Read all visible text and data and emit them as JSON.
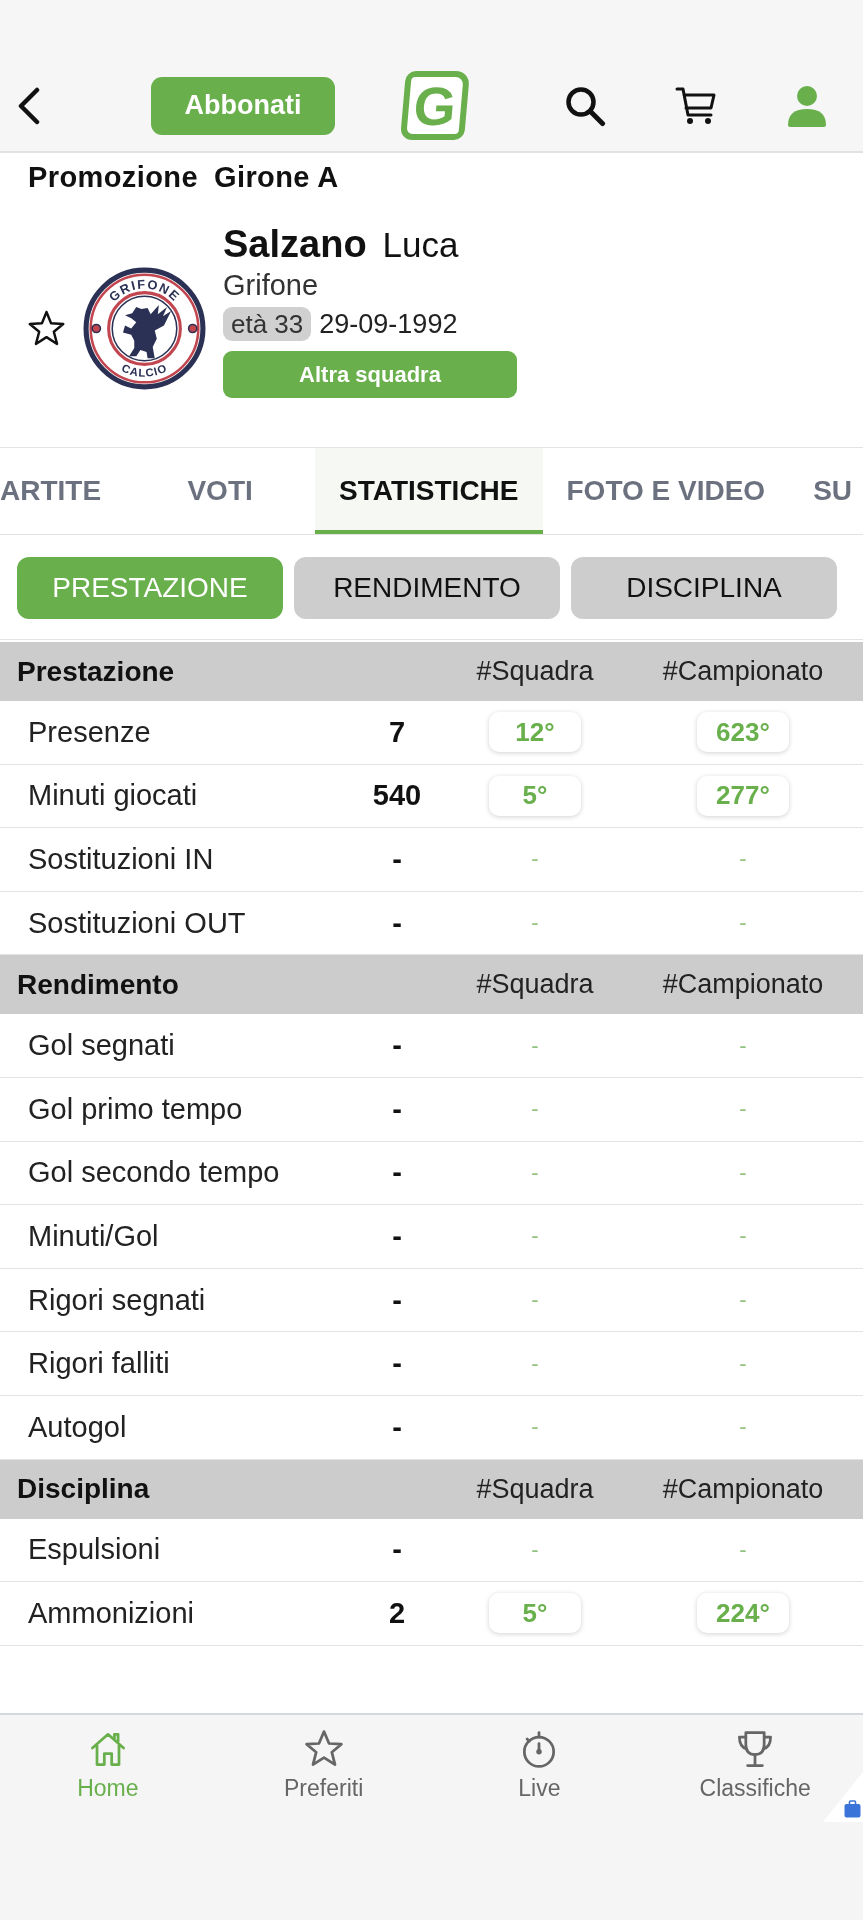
{
  "header": {
    "subscribe_button": "Abbonati",
    "logo": "G"
  },
  "competition": {
    "league": "Promozione",
    "group": "Girone A"
  },
  "player": {
    "surname": "Salzano",
    "name": "Luca",
    "team": "Grifone",
    "age": "età 33",
    "birth_date": "29-09-1992",
    "favorite": false,
    "crest": {
      "top_text": "GRIFONE",
      "bottom_text": "CALCIO"
    },
    "other_team_button": "Altra squadra"
  },
  "tabs": [
    {
      "label": "ARTITE",
      "selected": false
    },
    {
      "label": "VOTI",
      "selected": false
    },
    {
      "label": "STATISTICHE",
      "selected": true
    },
    {
      "label": "FOTO E VIDEO",
      "selected": false
    },
    {
      "label": "SU",
      "selected": false
    }
  ],
  "sub_tabs": [
    {
      "label": "PRESTAZIONE",
      "selected": true
    },
    {
      "label": "RENDIMENTO",
      "selected": false
    },
    {
      "label": "DISCIPLINA",
      "selected": false
    }
  ],
  "sections": [
    {
      "title": "Prestazione",
      "columns": [
        "#Squadra",
        "#Campionato"
      ],
      "rows": [
        {
          "label": "Presenze",
          "value": "7",
          "team_rank": "12°",
          "league_rank": "623°",
          "kind": "ranked"
        },
        {
          "label": "Minuti giocati",
          "value": "540",
          "team_rank": "5°",
          "league_rank": "277°",
          "kind": "ranked"
        },
        {
          "label": "Sostituzioni IN",
          "value": "-",
          "team_rank": "-",
          "league_rank": "-",
          "kind": "unranked"
        },
        {
          "label": "Sostituzioni OUT",
          "value": "-",
          "team_rank": "-",
          "league_rank": "-",
          "kind": "unranked"
        }
      ]
    },
    {
      "title": "Rendimento",
      "columns": [
        "#Squadra",
        "#Campionato"
      ],
      "rows": [
        {
          "label": "Gol segnati",
          "value": "-",
          "team_rank": "-",
          "league_rank": "-",
          "kind": "unranked"
        },
        {
          "label": "Gol primo tempo",
          "value": "-",
          "team_rank": "-",
          "league_rank": "-",
          "kind": "unranked"
        },
        {
          "label": "Gol secondo tempo",
          "value": "-",
          "team_rank": "-",
          "league_rank": "-",
          "kind": "unranked"
        },
        {
          "label": "Minuti/Gol",
          "value": "-",
          "team_rank": "-",
          "league_rank": "-",
          "kind": "unranked"
        },
        {
          "label": "Rigori segnati",
          "value": "-",
          "team_rank": "-",
          "league_rank": "-",
          "kind": "unranked"
        },
        {
          "label": "Rigori falliti",
          "value": "-",
          "team_rank": "-",
          "league_rank": "-",
          "kind": "unranked"
        },
        {
          "label": "Autogol",
          "value": "-",
          "team_rank": "-",
          "league_rank": "-",
          "kind": "unranked"
        }
      ]
    },
    {
      "title": "Disciplina",
      "columns": [
        "#Squadra",
        "#Campionato"
      ],
      "rows": [
        {
          "label": "Espulsioni",
          "value": "-",
          "team_rank": "-",
          "league_rank": "-",
          "kind": "unranked"
        },
        {
          "label": "Ammonizioni",
          "value": "2",
          "team_rank": "5°",
          "league_rank": "224°",
          "kind": "ranked"
        }
      ]
    }
  ],
  "bottom_nav": [
    {
      "label": "Home",
      "selected": true
    },
    {
      "label": "Preferiti",
      "selected": false
    },
    {
      "label": "Live",
      "selected": false
    },
    {
      "label": "Classifiche",
      "selected": false
    }
  ]
}
